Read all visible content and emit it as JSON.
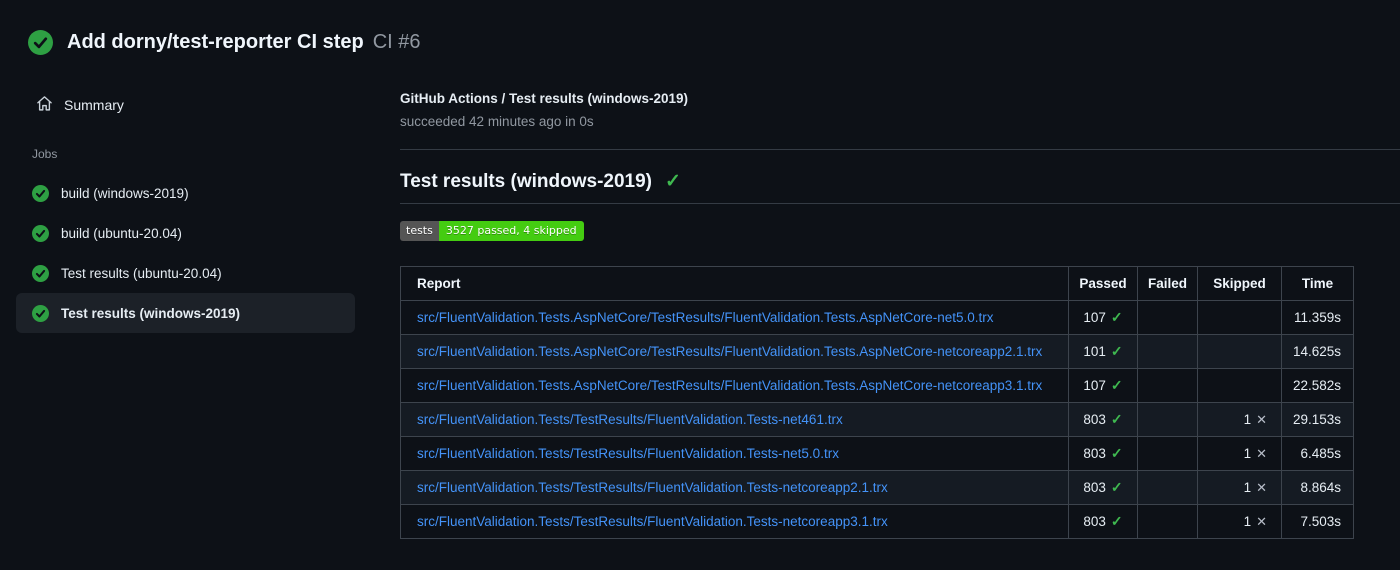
{
  "header": {
    "title": "Add dorny/test-reporter CI step",
    "run_number": "CI #6"
  },
  "sidebar": {
    "summary_label": "Summary",
    "jobs_label": "Jobs",
    "jobs": [
      {
        "label": "build (windows-2019)",
        "selected": false
      },
      {
        "label": "build (ubuntu-20.04)",
        "selected": false
      },
      {
        "label": "Test results (ubuntu-20.04)",
        "selected": false
      },
      {
        "label": "Test results (windows-2019)",
        "selected": true
      }
    ]
  },
  "main": {
    "check_title": "GitHub Actions / Test results (windows-2019)",
    "check_status": "succeeded 42 minutes ago in 0s",
    "section_heading": "Test results (windows-2019)",
    "badge": {
      "label": "tests",
      "value": "3527 passed, 4 skipped",
      "label_bg": "#555555",
      "value_bg": "#44cc11"
    },
    "table": {
      "columns": [
        "Report",
        "Passed",
        "Failed",
        "Skipped",
        "Time"
      ],
      "rows": [
        {
          "report": "src/FluentValidation.Tests.AspNetCore/TestResults/FluentValidation.Tests.AspNetCore-net5.0.trx",
          "passed": "107",
          "failed": "",
          "skipped": "",
          "time": "11.359s"
        },
        {
          "report": "src/FluentValidation.Tests.AspNetCore/TestResults/FluentValidation.Tests.AspNetCore-netcoreapp2.1.trx",
          "passed": "101",
          "failed": "",
          "skipped": "",
          "time": "14.625s"
        },
        {
          "report": "src/FluentValidation.Tests.AspNetCore/TestResults/FluentValidation.Tests.AspNetCore-netcoreapp3.1.trx",
          "passed": "107",
          "failed": "",
          "skipped": "",
          "time": "22.582s"
        },
        {
          "report": "src/FluentValidation.Tests/TestResults/FluentValidation.Tests-net461.trx",
          "passed": "803",
          "failed": "",
          "skipped": "1",
          "time": "29.153s"
        },
        {
          "report": "src/FluentValidation.Tests/TestResults/FluentValidation.Tests-net5.0.trx",
          "passed": "803",
          "failed": "",
          "skipped": "1",
          "time": "6.485s"
        },
        {
          "report": "src/FluentValidation.Tests/TestResults/FluentValidation.Tests-netcoreapp2.1.trx",
          "passed": "803",
          "failed": "",
          "skipped": "1",
          "time": "8.864s"
        },
        {
          "report": "src/FluentValidation.Tests/TestResults/FluentValidation.Tests-netcoreapp3.1.trx",
          "passed": "803",
          "failed": "",
          "skipped": "1",
          "time": "7.503s"
        }
      ]
    }
  },
  "icons": {
    "success_check": "check-circle",
    "heading_check": "✓",
    "pass_check": "✓",
    "skip_x": "✕",
    "home": "home"
  },
  "colors": {
    "page_bg": "#0d1117",
    "success_green": "#2ea043",
    "check_green": "#3fb950",
    "link_blue": "#4493f8",
    "muted_text": "#9198a1",
    "border": "#3d444d",
    "row_stripe": "#151b23",
    "selected_item_bg": "#1c2128"
  }
}
